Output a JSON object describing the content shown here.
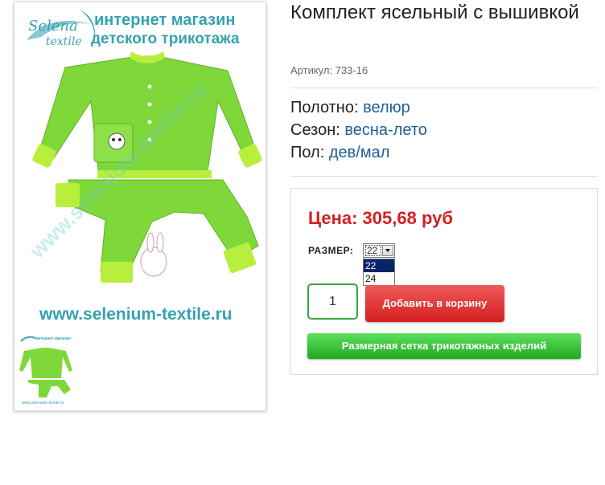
{
  "product": {
    "title": "Комплект ясельный с вышивкой",
    "sku_label": "Артикул:",
    "sku_value": "733-16"
  },
  "attributes": [
    {
      "label": "Полотно:",
      "value": "велюр"
    },
    {
      "label": "Сезон:",
      "value": "весна-лето"
    },
    {
      "label": "Пол:",
      "value": "дев/мал"
    }
  ],
  "image": {
    "brand_name": "Selena",
    "brand_sub": "textile",
    "store_line_1": "интернет магазин",
    "store_line_2": "детского трикотажа",
    "website": "www.selenium-textile.ru",
    "watermark": "www.selenium-textile.ru",
    "thumb_url": "www.selenium-textile.ru",
    "thumb_text": "интернет магазин"
  },
  "buy": {
    "price": "Цена: 305,68 руб",
    "size_label": "РАЗМЕР:",
    "size_selected": "22",
    "size_options": [
      "22",
      "24"
    ],
    "quantity": "1",
    "add_to_cart": "Добавить в корзину",
    "size_chart": "Размерная сетка трикотажных изделий"
  },
  "colors": {
    "price": "#d51f1f",
    "attr_value": "#1e5f99",
    "add_button": "#d41e1e",
    "size_chart_button": "#1fa81f",
    "qty_border": "#3aa63a"
  },
  "icons": [
    "dropdown-arrow-icon"
  ]
}
